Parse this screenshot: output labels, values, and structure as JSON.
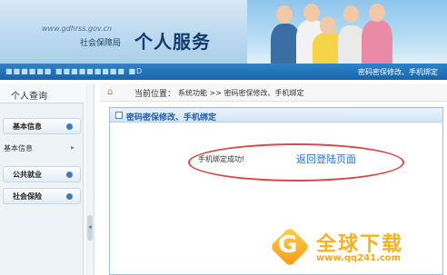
{
  "header": {
    "site_url": "www.gdhrss.gov.cn",
    "site_name": "社会保障局",
    "title": "个人服务"
  },
  "navbar": {
    "left_text": "■■■■■■  ■■■■■■■■■ ■D",
    "right_text": "密码密保修改、手机绑定"
  },
  "sidebar": {
    "heading": "个人查询",
    "items": [
      {
        "label": "基本信息"
      },
      {
        "label": "公共就业"
      },
      {
        "label": "社会保险"
      }
    ],
    "sub_items": [
      {
        "label": "基本信息",
        "arrow": "▸"
      }
    ]
  },
  "breadcrumb": {
    "home_icon": "house-icon",
    "label": "当前位置：",
    "path": "系统功能 >> 密码密保修改、手机绑定"
  },
  "panel": {
    "title": "密码密保修改、手机绑定",
    "message": "手机绑定成功!",
    "link": "返回登陆页面"
  },
  "watermark": {
    "logo_letter": "G",
    "name": "全球下载",
    "url": "www.qq241.com"
  },
  "colors": {
    "navbar": "#1766ad",
    "link": "#2d6fc4",
    "highlight_ellipse": "#d94747",
    "watermark": "#f4b21f"
  }
}
